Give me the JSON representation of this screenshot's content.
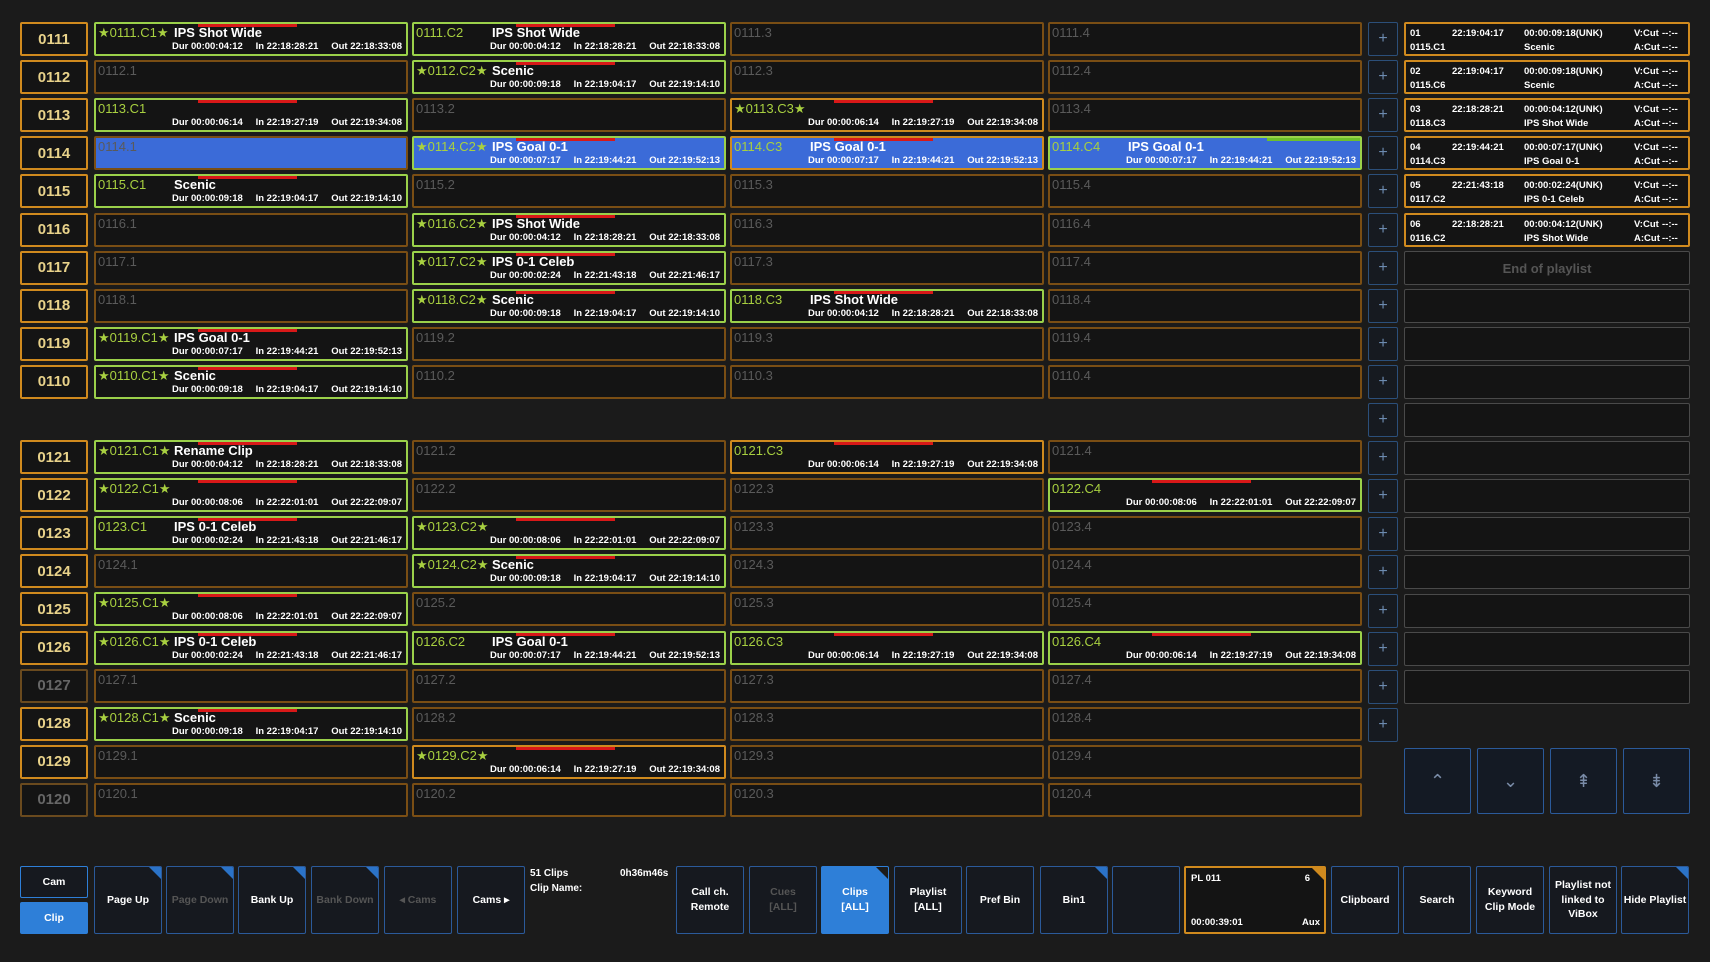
{
  "grid": {
    "bank_groups": [
      [
        {
          "label": "0111",
          "clips": [
            {
              "id": "0111.C1",
              "star": true,
              "title": "IPS Shot Wide",
              "dur": "Dur 00:00:04:12",
              "in": "In 22:18:28:21",
              "out": "Out 22:18:33:08",
              "state": "green",
              "bar": "r"
            },
            {
              "id": "0111.C2",
              "title": "IPS Shot Wide",
              "dur": "Dur 00:00:04:12",
              "in": "In 22:18:28:21",
              "out": "Out 22:18:33:08",
              "state": "green",
              "bar": "r"
            },
            {
              "id": "0111.3"
            },
            {
              "id": "0111.4"
            }
          ]
        },
        {
          "label": "0112",
          "clips": [
            {
              "id": "0112.1"
            },
            {
              "id": "0112.C2",
              "star": true,
              "title": "Scenic",
              "dur": "Dur 00:00:09:18",
              "in": "In 22:19:04:17",
              "out": "Out 22:19:14:10",
              "state": "green",
              "bar": "r"
            },
            {
              "id": "0112.3"
            },
            {
              "id": "0112.4"
            }
          ]
        },
        {
          "label": "0113",
          "clips": [
            {
              "id": "0113.C1",
              "title": "",
              "dur": "Dur 00:00:06:14",
              "in": "In 22:19:27:19",
              "out": "Out 22:19:34:08",
              "state": "green",
              "bar": "r"
            },
            {
              "id": "0113.2"
            },
            {
              "id": "0113.C3",
              "star": true,
              "title": "",
              "dur": "Dur 00:00:06:14",
              "in": "In 22:19:27:19",
              "out": "Out 22:19:34:08",
              "state": "filled",
              "bar": "r"
            },
            {
              "id": "0113.4"
            }
          ]
        },
        {
          "label": "0114",
          "clips": [
            {
              "id": "0114.1",
              "state": "sel"
            },
            {
              "id": "0114.C2",
              "star": true,
              "title": "IPS Goal 0-1",
              "dur": "Dur 00:00:07:17",
              "in": "In 22:19:44:21",
              "out": "Out 22:19:52:13",
              "state": "green",
              "sel": true,
              "bar": "r"
            },
            {
              "id": "0114.C3",
              "title": "IPS Goal 0-1",
              "dur": "Dur 00:00:07:17",
              "in": "In 22:19:44:21",
              "out": "Out 22:19:52:13",
              "state": "filled",
              "sel": true,
              "bar": "r"
            },
            {
              "id": "0114.C4",
              "title": "IPS Goal 0-1",
              "dur": "Dur 00:00:07:17",
              "in": "In 22:19:44:21",
              "out": "Out 22:19:52:13",
              "state": "green",
              "sel": true,
              "bar": "g"
            }
          ]
        },
        {
          "label": "0115",
          "clips": [
            {
              "id": "0115.C1",
              "title": "Scenic",
              "dur": "Dur 00:00:09:18",
              "in": "In 22:19:04:17",
              "out": "Out 22:19:14:10",
              "state": "green",
              "bar": "r"
            },
            {
              "id": "0115.2"
            },
            {
              "id": "0115.3"
            },
            {
              "id": "0115.4"
            }
          ]
        },
        {
          "label": "0116",
          "clips": [
            {
              "id": "0116.1"
            },
            {
              "id": "0116.C2",
              "star": true,
              "title": "IPS Shot Wide",
              "dur": "Dur 00:00:04:12",
              "in": "In 22:18:28:21",
              "out": "Out 22:18:33:08",
              "state": "green",
              "bar": "r"
            },
            {
              "id": "0116.3"
            },
            {
              "id": "0116.4"
            }
          ]
        },
        {
          "label": "0117",
          "clips": [
            {
              "id": "0117.1"
            },
            {
              "id": "0117.C2",
              "star": true,
              "title": "IPS 0-1 Celeb",
              "dur": "Dur 00:00:02:24",
              "in": "In 22:21:43:18",
              "out": "Out 22:21:46:17",
              "state": "green",
              "bar": "r"
            },
            {
              "id": "0117.3"
            },
            {
              "id": "0117.4"
            }
          ]
        },
        {
          "label": "0118",
          "clips": [
            {
              "id": "0118.1"
            },
            {
              "id": "0118.C2",
              "star": true,
              "title": "Scenic",
              "dur": "Dur 00:00:09:18",
              "in": "In 22:19:04:17",
              "out": "Out 22:19:14:10",
              "state": "green",
              "bar": "r"
            },
            {
              "id": "0118.C3",
              "title": "IPS Shot Wide",
              "dur": "Dur 00:00:04:12",
              "in": "In 22:18:28:21",
              "out": "Out 22:18:33:08",
              "state": "green",
              "bar": "r"
            },
            {
              "id": "0118.4"
            }
          ]
        },
        {
          "label": "0119",
          "clips": [
            {
              "id": "0119.C1",
              "star": true,
              "title": "IPS Goal 0-1",
              "dur": "Dur 00:00:07:17",
              "in": "In 22:19:44:21",
              "out": "Out 22:19:52:13",
              "state": "green",
              "bar": "r"
            },
            {
              "id": "0119.2"
            },
            {
              "id": "0119.3"
            },
            {
              "id": "0119.4"
            }
          ]
        },
        {
          "label": "0110",
          "clips": [
            {
              "id": "0110.C1",
              "star": true,
              "title": "Scenic",
              "dur": "Dur 00:00:09:18",
              "in": "In 22:19:04:17",
              "out": "Out 22:19:14:10",
              "state": "green",
              "bar": "r"
            },
            {
              "id": "0110.2"
            },
            {
              "id": "0110.3"
            },
            {
              "id": "0110.4"
            }
          ]
        }
      ],
      [
        {
          "label": "0121",
          "clips": [
            {
              "id": "0121.C1",
              "star": true,
              "title": "Rename Clip",
              "dur": "Dur 00:00:04:12",
              "in": "In 22:18:28:21",
              "out": "Out 22:18:33:08",
              "state": "green",
              "bar": "r"
            },
            {
              "id": "0121.2"
            },
            {
              "id": "0121.C3",
              "title": "",
              "dur": "Dur 00:00:06:14",
              "in": "In 22:19:27:19",
              "out": "Out 22:19:34:08",
              "state": "filled",
              "bar": "r"
            },
            {
              "id": "0121.4"
            }
          ]
        },
        {
          "label": "0122",
          "clips": [
            {
              "id": "0122.C1",
              "star": true,
              "title": "",
              "dur": "Dur 00:00:08:06",
              "in": "In 22:22:01:01",
              "out": "Out 22:22:09:07",
              "state": "green",
              "bar": "r"
            },
            {
              "id": "0122.2"
            },
            {
              "id": "0122.3"
            },
            {
              "id": "0122.C4",
              "title": "",
              "dur": "Dur 00:00:08:06",
              "in": "In 22:22:01:01",
              "out": "Out 22:22:09:07",
              "state": "green",
              "bar": "r"
            }
          ]
        },
        {
          "label": "0123",
          "clips": [
            {
              "id": "0123.C1",
              "title": "IPS 0-1 Celeb",
              "dur": "Dur 00:00:02:24",
              "in": "In 22:21:43:18",
              "out": "Out 22:21:46:17",
              "state": "green",
              "bar": "r"
            },
            {
              "id": "0123.C2",
              "star": true,
              "title": "",
              "dur": "Dur 00:00:08:06",
              "in": "In 22:22:01:01",
              "out": "Out 22:22:09:07",
              "state": "green",
              "bar": "r"
            },
            {
              "id": "0123.3"
            },
            {
              "id": "0123.4"
            }
          ]
        },
        {
          "label": "0124",
          "clips": [
            {
              "id": "0124.1"
            },
            {
              "id": "0124.C2",
              "star": true,
              "title": "Scenic",
              "dur": "Dur 00:00:09:18",
              "in": "In 22:19:04:17",
              "out": "Out 22:19:14:10",
              "state": "green",
              "bar": "r"
            },
            {
              "id": "0124.3"
            },
            {
              "id": "0124.4"
            }
          ]
        },
        {
          "label": "0125",
          "clips": [
            {
              "id": "0125.C1",
              "star": true,
              "title": "",
              "dur": "Dur 00:00:08:06",
              "in": "In 22:22:01:01",
              "out": "Out 22:22:09:07",
              "state": "green",
              "bar": "r"
            },
            {
              "id": "0125.2"
            },
            {
              "id": "0125.3"
            },
            {
              "id": "0125.4"
            }
          ]
        },
        {
          "label": "0126",
          "clips": [
            {
              "id": "0126.C1",
              "star": true,
              "title": "IPS 0-1 Celeb",
              "dur": "Dur 00:00:02:24",
              "in": "In 22:21:43:18",
              "out": "Out 22:21:46:17",
              "state": "green",
              "bar": "r"
            },
            {
              "id": "0126.C2",
              "title": "IPS Goal 0-1",
              "dur": "Dur 00:00:07:17",
              "in": "In 22:19:44:21",
              "out": "Out 22:19:52:13",
              "state": "green",
              "bar": "r"
            },
            {
              "id": "0126.C3",
              "title": "",
              "dur": "Dur 00:00:06:14",
              "in": "In 22:19:27:19",
              "out": "Out 22:19:34:08",
              "state": "green",
              "bar": "r"
            },
            {
              "id": "0126.C4",
              "title": "",
              "dur": "Dur 00:00:06:14",
              "in": "In 22:19:27:19",
              "out": "Out 22:19:34:08",
              "state": "green",
              "bar": "r"
            }
          ]
        },
        {
          "label": "0127",
          "dim": true,
          "clips": [
            {
              "id": "0127.1"
            },
            {
              "id": "0127.2"
            },
            {
              "id": "0127.3"
            },
            {
              "id": "0127.4"
            }
          ]
        },
        {
          "label": "0128",
          "clips": [
            {
              "id": "0128.C1",
              "star": true,
              "title": "Scenic",
              "dur": "Dur 00:00:09:18",
              "in": "In 22:19:04:17",
              "out": "Out 22:19:14:10",
              "state": "green",
              "bar": "r"
            },
            {
              "id": "0128.2"
            },
            {
              "id": "0128.3"
            },
            {
              "id": "0128.4"
            }
          ]
        },
        {
          "label": "0129",
          "clips": [
            {
              "id": "0129.1"
            },
            {
              "id": "0129.C2",
              "star": true,
              "title": "",
              "dur": "Dur 00:00:06:14",
              "in": "In 22:19:27:19",
              "out": "Out 22:19:34:08",
              "state": "filled",
              "bar": "r"
            },
            {
              "id": "0129.3"
            },
            {
              "id": "0129.4"
            }
          ]
        },
        {
          "label": "0120",
          "dim": true,
          "clips": [
            {
              "id": "0120.1"
            },
            {
              "id": "0120.2"
            },
            {
              "id": "0120.3"
            },
            {
              "id": "0120.4"
            }
          ]
        }
      ]
    ],
    "plus_glyph": "+",
    "plus_count": 19
  },
  "playlist": {
    "entries": [
      {
        "num": "01",
        "time": "22:19:04:17",
        "dur": "00:00:09:18(UNK)",
        "clip": "0115.C1",
        "name": "Scenic",
        "v": "V:Cut",
        "a": "A:Cut",
        "vv": "--:--",
        "av": "--:--"
      },
      {
        "num": "02",
        "time": "22:19:04:17",
        "dur": "00:00:09:18(UNK)",
        "clip": "0115.C6",
        "name": "Scenic",
        "v": "V:Cut",
        "a": "A:Cut",
        "vv": "--:--",
        "av": "--:--"
      },
      {
        "num": "03",
        "time": "22:18:28:21",
        "dur": "00:00:04:12(UNK)",
        "clip": "0118.C3",
        "name": "IPS Shot Wide",
        "v": "V:Cut",
        "a": "A:Cut",
        "vv": "--:--",
        "av": "--:--"
      },
      {
        "num": "04",
        "time": "22:19:44:21",
        "dur": "00:00:07:17(UNK)",
        "clip": "0114.C3",
        "name": "IPS Goal 0-1",
        "v": "V:Cut",
        "a": "A:Cut",
        "vv": "--:--",
        "av": "--:--"
      },
      {
        "num": "05",
        "time": "22:21:43:18",
        "dur": "00:00:02:24(UNK)",
        "clip": "0117.C2",
        "name": "IPS 0-1 Celeb",
        "v": "V:Cut",
        "a": "A:Cut",
        "vv": "--:--",
        "av": "--:--"
      },
      {
        "num": "06",
        "time": "22:18:28:21",
        "dur": "00:00:04:12(UNK)",
        "clip": "0116.C2",
        "name": "IPS Shot Wide",
        "v": "V:Cut",
        "a": "A:Cut",
        "vv": "--:--",
        "av": "--:--"
      }
    ],
    "end_label": "End of playlist",
    "empty_rows": 12,
    "nav": [
      {
        "name": "scroll-up-icon",
        "glyph": "⌃"
      },
      {
        "name": "scroll-down-icon",
        "glyph": "⌄"
      },
      {
        "name": "page-up-icon",
        "glyph": "⇞"
      },
      {
        "name": "page-down-icon",
        "glyph": "⇟"
      }
    ]
  },
  "toolbar": {
    "cam": "Cam",
    "clip": "Clip",
    "page_up": "Page Up",
    "page_down": "Page Down",
    "bank_up": "Bank Up",
    "bank_down": "Bank Down",
    "cams_prev": "◂  Cams",
    "cams_next": "Cams  ▸",
    "clips_count": "51 Clips",
    "clip_name_label": "Clip Name:",
    "total_duration": "0h36m46s",
    "call_ch": "Call ch.\nRemote",
    "cues": "Cues\n[ALL]",
    "clips_all": "Clips\n[ALL]",
    "playlist_all": "Playlist\n[ALL]",
    "pref_bin": "Pref Bin",
    "bin1": "Bin1",
    "blank": "",
    "pl_title": "PL 011",
    "pl_count": "6",
    "pl_duration": "00:00:39:01",
    "pl_aux": "Aux",
    "clipboard": "Clipboard",
    "search": "Search",
    "keyword": "Keyword\nClip Mode",
    "playlist_link": "Playlist not\nlinked to\nViBox",
    "hide_playlist": "Hide Playlist"
  },
  "colors": {
    "accent": "#2e7fd8",
    "selected": "#3b6bd8",
    "orange": "#cf8a1e",
    "green": "#9bd14a",
    "red": "#d81818"
  }
}
